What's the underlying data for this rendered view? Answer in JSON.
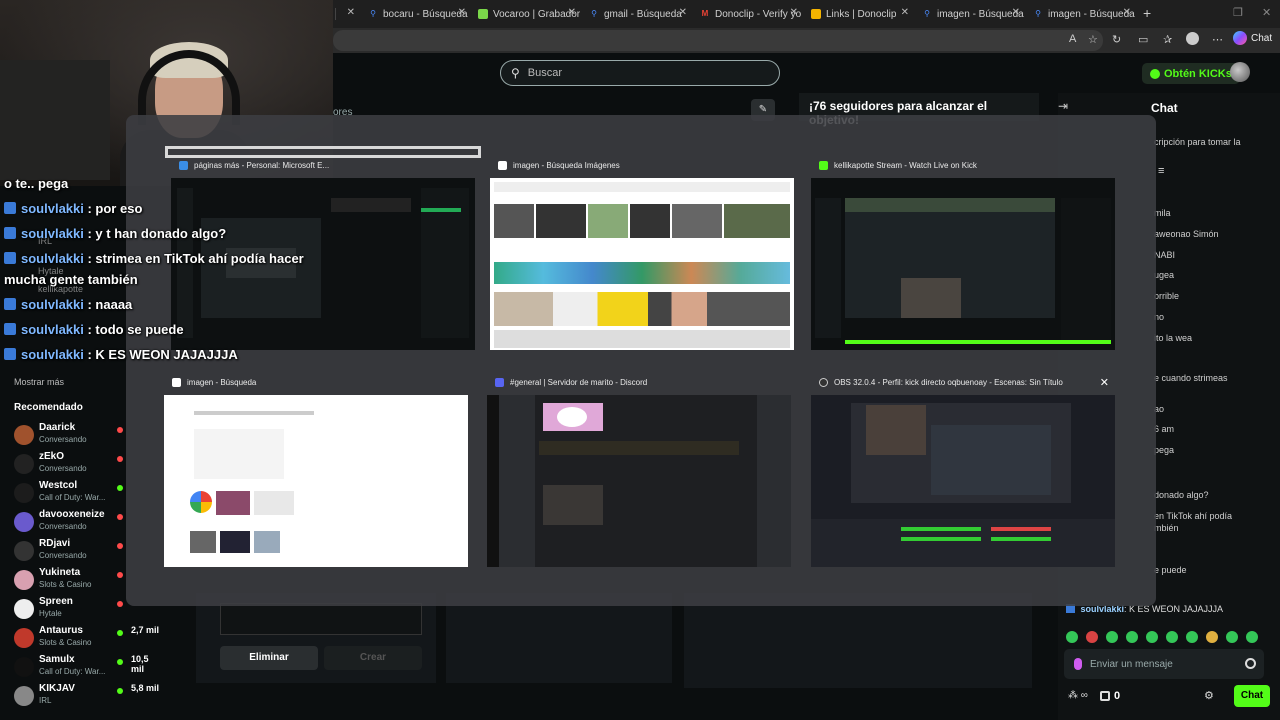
{
  "browser": {
    "tabs": [
      {
        "label": "bocaru - Búsqueda",
        "icon": "search-icon",
        "color": "#4a8cff"
      },
      {
        "label": "Vocaroo | Grabador",
        "icon": "vocaroo-icon",
        "color": "#7bd84a"
      },
      {
        "label": "gmail - Búsqueda",
        "icon": "search-icon",
        "color": "#4a8cff"
      },
      {
        "label": "Donoclip - Verify yo",
        "icon": "gmail-icon",
        "color": "#ea4335"
      },
      {
        "label": "Links | Donoclip",
        "icon": "donoclip-icon",
        "color": "#f5b400"
      },
      {
        "label": "imagen - Búsqueda",
        "icon": "search-icon",
        "color": "#4a8cff"
      },
      {
        "label": "imagen - Búsqueda",
        "icon": "search-icon",
        "color": "#4a8cff"
      }
    ],
    "copilot_label": "Chat"
  },
  "kick": {
    "search_placeholder": "Buscar",
    "get_kicks": "Obtén KICKs",
    "goal_text": "¡76 seguidores para alcanzar el objetivo!",
    "bg_fragment": "ores",
    "sidebar": {
      "more": "Mostrar más",
      "recommended_title": "Recomendado",
      "channels": [
        {
          "name": "Daarick",
          "sub": "Conversando",
          "viewers": "",
          "color": "#a0522d"
        },
        {
          "name": "zEkO",
          "sub": "Conversando",
          "viewers": "",
          "color": "#222"
        },
        {
          "name": "Westcol",
          "sub": "Call of Duty: War...",
          "viewers": "",
          "color": "#1c1c1c"
        },
        {
          "name": "davooxeneize",
          "sub": "Conversando",
          "viewers": "",
          "color": "#6a5acd"
        },
        {
          "name": "RDjavi",
          "sub": "Conversando",
          "viewers": "",
          "color": "#333"
        },
        {
          "name": "Yukineta",
          "sub": "Slots & Casino",
          "viewers": "",
          "color": "#d8a0b0"
        },
        {
          "name": "Spreen",
          "sub": "Hytale",
          "viewers": "",
          "color": "#eee"
        },
        {
          "name": "Antaurus",
          "sub": "Slots & Casino",
          "viewers": "2,7 mil",
          "color": "#c0392b"
        },
        {
          "name": "Samulx",
          "sub": "Call of Duty: War...",
          "viewers": "10,5 mil",
          "color": "#111"
        },
        {
          "name": "KIKJAV",
          "sub": "IRL",
          "viewers": "5,8 mil",
          "color": "#888"
        }
      ]
    },
    "form": {
      "delete": "Eliminar",
      "create": "Crear"
    },
    "chat": {
      "title": "Chat",
      "fragments": [
        "cripción para tomar la",
        "mila",
        "aweonao Simón",
        "NABI",
        "ugea",
        "orrible",
        "no",
        "ito la wea",
        "e cuando strimeas",
        "ao",
        "6 am",
        "pega",
        "donado algo?",
        "en TikTok ahí podía",
        "mbién",
        "e puede"
      ],
      "last_name": "soulvlakki",
      "last_text": ": K ES WEON JAJAJJJA",
      "input_placeholder": "Enviar un mensaje",
      "points": "0",
      "chat_button": "Chat"
    }
  },
  "overlay": {
    "lines": [
      {
        "name": "",
        "text": "o te..  pega"
      },
      {
        "name": "soulvlakki",
        "text": " : por eso"
      },
      {
        "name": "soulvlakki",
        "text": " : y t han donado algo?"
      },
      {
        "name": "soulvlakki",
        "text": " : strimea en TikTok ahí podía hacer"
      },
      {
        "name": "",
        "text": "mucha gente también"
      },
      {
        "name": "soulvlakki",
        "text": " : naaaa"
      },
      {
        "name": "soulvlakki",
        "text": " : todo se puede"
      },
      {
        "name": "soulvlakki",
        "text": " : K ES WEON JAJAJJJA"
      }
    ],
    "faint": [
      "IRL",
      "Hytale",
      "kellikapotte"
    ]
  },
  "switcher": {
    "windows": [
      {
        "title": "páginas más - Personal: Microsoft E...",
        "icon": "edge-icon",
        "theme": "dark",
        "selected": true
      },
      {
        "title": "imagen - Búsqueda Imágenes",
        "icon": "bing-icon",
        "theme": "images",
        "selected": false
      },
      {
        "title": "kellikapotte Stream - Watch Live on Kick",
        "icon": "kick-icon",
        "theme": "dark",
        "selected": false
      },
      {
        "title": "imagen - Búsqueda",
        "icon": "bing-icon",
        "theme": "light",
        "selected": false
      },
      {
        "title": "#general | Servidor de marito - Discord",
        "icon": "discord-icon",
        "theme": "discord",
        "selected": false
      },
      {
        "title": "OBS 32.0.4 - Perfil: kick directo oqbuenoay - Escenas: Sin Título",
        "icon": "obs-icon",
        "theme": "obs",
        "selected": false
      }
    ]
  },
  "colors": {
    "kick_green": "#53fc18",
    "name_blue": "#7fb8ff"
  }
}
